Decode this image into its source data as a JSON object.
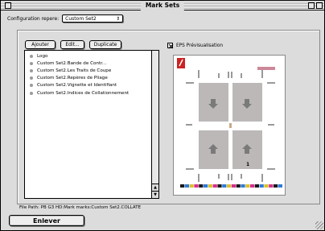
{
  "window": {
    "title": "Mark Sets"
  },
  "config": {
    "label": "Configuration repere:",
    "selected": "Custom Set2",
    "arrow_glyph": "⇕"
  },
  "buttons": {
    "add": "Ajouter",
    "edit": "Edit...",
    "duplicate": "Duplicate",
    "remove": "Enlever"
  },
  "list": {
    "items": [
      "Logo",
      "Custom Set2.Bande de Contr...",
      "Custom Set2.Les Traits de Coupe",
      "Custom Set2.Repères de Pliage",
      "Custom Set2.Vignette et Identifiant",
      "Custom Set2.Indices de Collationnement"
    ],
    "scroll_up_glyph": "▲",
    "scroll_down_glyph": "▼"
  },
  "preview": {
    "checkbox_label": "EPS Prévisualisation",
    "checked": true,
    "page_number": "1"
  },
  "status": {
    "file_path": "File Path: PB G3 HD:Mark marks:Custom Set2.COLLATE"
  },
  "colors": {
    "window_bg": "#dcdcdc",
    "logo_red": "#cc2222",
    "panel_gray": "#bcb8b8",
    "arrow_gray": "#7a7a7a",
    "color_bar": [
      "#1a1a1a",
      "#2f7bd9",
      "#d9c22f",
      "#d92f8f",
      "#1a1a1a",
      "#2f7bd9",
      "#d9c22f",
      "#d92f8f",
      "#1a1a1a",
      "#2f7bd9",
      "#d9c22f",
      "#d92f8f",
      "#1a1a1a",
      "#2f7bd9",
      "#d9c22f",
      "#d92f8f",
      "#1a1a1a",
      "#2f7bd9",
      "#d9c22f",
      "#d92f8f",
      "#1a1a1a",
      "#2f7bd9"
    ]
  }
}
